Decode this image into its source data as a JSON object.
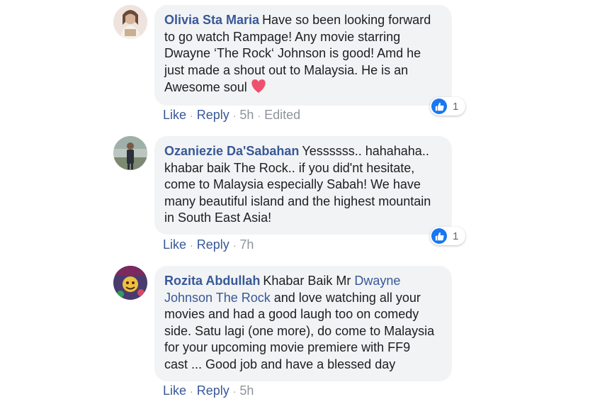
{
  "comments": [
    {
      "author": "Olivia Sta Maria",
      "lines": [
        "Have so been looking forward",
        "to go watch Rampage! Any movie starring",
        "Dwayne ‘The Rock‘ Johnson is good! Amd he",
        "just made a shout out to Malaysia. He is an",
        "Awesome soul"
      ],
      "reaction_count": "1",
      "actions": {
        "like": "Like",
        "reply": "Reply",
        "time": "5h",
        "edited": "Edited"
      }
    },
    {
      "author": "Ozaniezie Da'Sabahan",
      "lines": [
        "Yessssss.. hahahaha..",
        "khabar baik The Rock.. if you did'nt hesitate,",
        "come to Malaysia especially Sabah! We have",
        "many beautiful island and the highest mountain",
        "in South East Asia!"
      ],
      "reaction_count": "1",
      "actions": {
        "like": "Like",
        "reply": "Reply",
        "time": "7h"
      }
    },
    {
      "author": "Rozita Abdullah",
      "first_text": "Khabar Baik Mr",
      "mention_a": "Dwayne",
      "mention_b": "Johnson The Rock",
      "after_mention": " and love watching all your",
      "lines": [
        "movies and had a good laugh too on comedy",
        "side. Satu lagi (one more), do come to Malaysia",
        "for your upcoming movie premiere with FF9",
        "cast ... Good job and have a blessed day"
      ],
      "actions": {
        "like": "Like",
        "reply": "Reply",
        "time": "5h"
      }
    }
  ],
  "colors": {
    "author_link": "#385898",
    "bubble_bg": "#f2f3f5",
    "meta_gray": "#90949c",
    "like_blue": "#1877f2",
    "heart": "#f0506e"
  },
  "icons": [
    "heart-icon",
    "like-thumb-icon"
  ]
}
